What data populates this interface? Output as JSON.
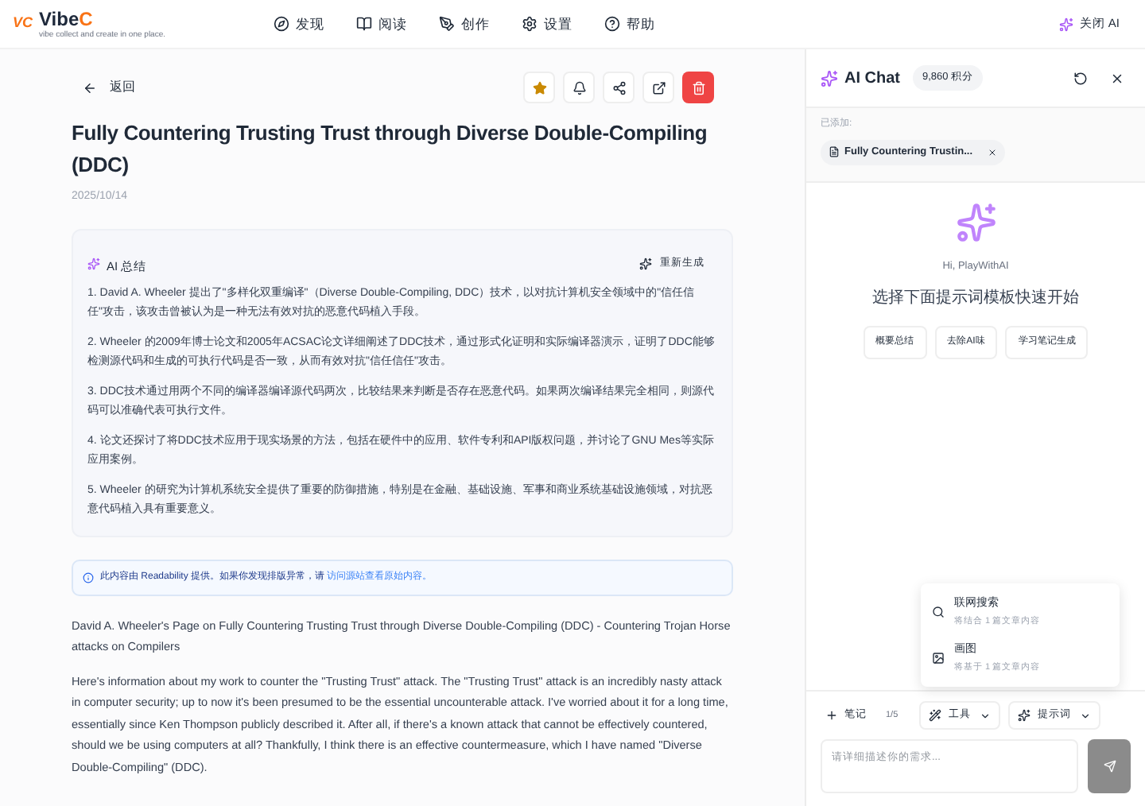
{
  "header": {
    "logo_mark": "VC",
    "brand_main": "Vibe",
    "brand_accent": "C",
    "tagline": "vibe collect and create in one place.",
    "nav": [
      {
        "label": "发现",
        "kind": "compass"
      },
      {
        "label": "阅读",
        "kind": "book"
      },
      {
        "label": "创作",
        "kind": "pen"
      },
      {
        "label": "设置",
        "kind": "gear"
      },
      {
        "label": "帮助",
        "kind": "help"
      }
    ],
    "ai_toggle": "关闭 AI"
  },
  "article": {
    "back": "返回",
    "starred": true,
    "title": "Fully Countering Trusting Trust through Diverse Double-Compiling (DDC)",
    "date": "2025/10/14",
    "summary": {
      "title": "AI 总结",
      "regenerate": "重新生成",
      "items": [
        "1. David A. Wheeler 提出了\"多样化双重编译\"（Diverse Double-Compiling, DDC）技术，以对抗计算机安全领域中的\"信任信任\"攻击，该攻击曾被认为是一种无法有效对抗的恶意代码植入手段。",
        "2. Wheeler 的2009年博士论文和2005年ACSAC论文详细阐述了DDC技术，通过形式化证明和实际编译器演示，证明了DDC能够检测源代码和生成的可执行代码是否一致，从而有效对抗\"信任信任\"攻击。",
        "3. DDC技术通过用两个不同的编译器编译源代码两次，比较结果来判断是否存在恶意代码。如果两次编译结果完全相同，则源代码可以准确代表可执行文件。",
        "4. 论文还探讨了将DDC技术应用于现实场景的方法，包括在硬件中的应用、软件专利和API版权问题，并讨论了GNU Mes等实际应用案例。",
        "5. Wheeler 的研究为计算机系统安全提供了重要的防御措施，特别是在金融、基础设施、军事和商业系统基础设施领域，对抗恶意代码植入具有重要意义。"
      ]
    },
    "notice": {
      "text": "此内容由 Readability 提供。如果你发现排版异常，请",
      "link": "访问源站查看原始内容。"
    },
    "paragraphs": [
      "David A. Wheeler's Page on Fully Countering Trusting Trust through Diverse Double-Compiling (DDC) - Countering Trojan Horse attacks on Compilers",
      "Here's information about my work to counter the \"Trusting Trust\" attack. The \"Trusting Trust\" attack is an incredibly nasty attack in computer security; up to now it's been presumed to be the essential uncounterable attack. I've worried about it for a long time, essentially since Ken Thompson publicly described it. After all, if there's a known attack that cannot be effectively countered, should we be using computers at all? Thankfully, I think there is an effective countermeasure, which I have named \"Diverse Double-Compiling\" (DDC)."
    ]
  },
  "chat": {
    "title": "AI Chat",
    "points": "9,860 积分",
    "added_label": "已添加:",
    "attachment": "Fully Countering Trustin...",
    "greeting": "Hi, PlayWithAI",
    "prompt_title": "选择下面提示词模板快速开始",
    "templates": [
      "概要总结",
      "去除AI味",
      "学习笔记生成"
    ],
    "menu": [
      {
        "kind": "search",
        "title": "联网搜索",
        "desc": "将结合 1 篇文章内容"
      },
      {
        "kind": "image",
        "title": "画图",
        "desc": "将基于 1 篇文章内容"
      }
    ],
    "notes": "笔记",
    "notes_count": "1/5",
    "tools": "工具",
    "prompts": "提示词",
    "placeholder": "请详细描述你的需求..."
  }
}
